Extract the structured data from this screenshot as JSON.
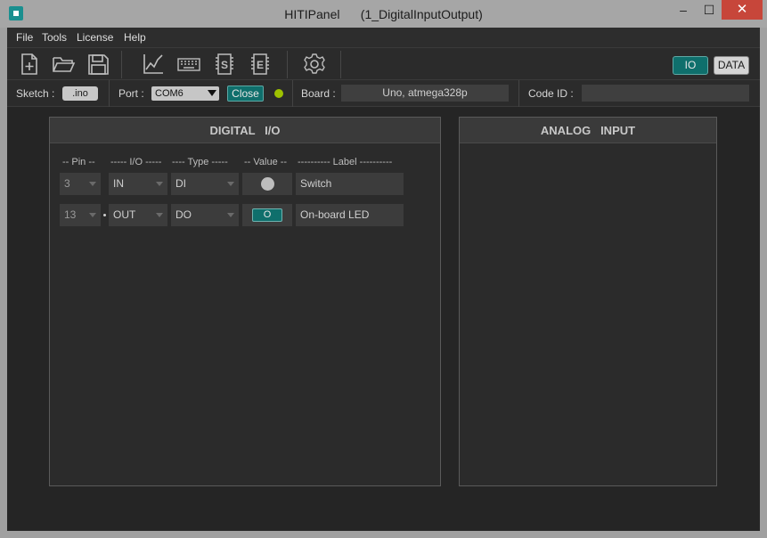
{
  "window": {
    "title": "HITIPanel      (1_DigitalInputOutput)",
    "controls": {
      "minimize": "–",
      "maximize": "☐",
      "close": "✕"
    }
  },
  "menu": {
    "items": [
      "File",
      "Tools",
      "License",
      "Help"
    ]
  },
  "toolbar": {
    "icons": [
      "new-file-icon",
      "open-folder-icon",
      "save-icon",
      "chart-icon",
      "keyboard-icon",
      "serial-s-icon",
      "eeprom-e-icon",
      "settings-gear-icon"
    ],
    "io_label": "IO",
    "data_label": "DATA"
  },
  "infobar": {
    "sketch_label": "Sketch :",
    "sketch_button": ".ino",
    "port_label": "Port :",
    "port_value": "COM6",
    "close_label": "Close",
    "status_color": "#9ec200",
    "board_label": "Board :",
    "board_value": "Uno, atmega328p",
    "codeid_label": "Code ID :",
    "codeid_value": ""
  },
  "digital": {
    "title": "DIGITAL   I/O",
    "headers": {
      "pin": "-- Pin --",
      "io": "----- I/O -----",
      "type": "---- Type -----",
      "value": "-- Value --",
      "label": "---------- Label ----------"
    },
    "rows": [
      {
        "pin": "3",
        "io": "IN",
        "type": "DI",
        "value": "",
        "label": "Switch"
      },
      {
        "pin": "13",
        "io": "OUT",
        "type": "DO",
        "value": "O",
        "label": "On-board LED"
      }
    ]
  },
  "analog": {
    "title": "ANALOG   INPUT"
  },
  "colors": {
    "accent": "#0f6f6c",
    "background": "#252525",
    "panel": "#2b2b2b"
  }
}
